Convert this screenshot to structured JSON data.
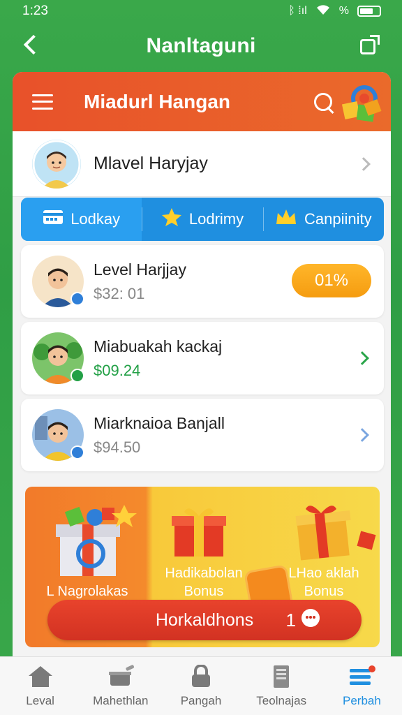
{
  "status_bar": {
    "time": "1:23",
    "signal": "ᛒ ⁞ıl",
    "battery_text": "%"
  },
  "top_nav": {
    "title": "Nanltaguni"
  },
  "header": {
    "title": "Miadurl Hangan"
  },
  "profile": {
    "name": "Mlavel Haryjay"
  },
  "tabs": [
    {
      "label": "Lodkay",
      "icon": "card-icon"
    },
    {
      "label": "Lodrimy",
      "icon": "star-icon"
    },
    {
      "label": "Canpiinity",
      "icon": "crown-icon"
    }
  ],
  "list": [
    {
      "name": "Level Harjjay",
      "amount": "$32: 01",
      "pill": "01%"
    },
    {
      "name": "Miabuakah kackaj",
      "amount": "$09.24"
    },
    {
      "name": "Miarknaioa Banjall",
      "amount": "$94.50"
    }
  ],
  "promo": {
    "left_label": "L Nagrolakas",
    "mid_label_1": "Hadikabolan",
    "mid_label_2": "Bonus",
    "right_label_1": "LHao aklah",
    "right_label_2": "Bonus",
    "button": "Horkaldhons",
    "count": "1"
  },
  "bottom_nav": [
    {
      "label": "Leval"
    },
    {
      "label": "Mahethlan"
    },
    {
      "label": "Pangah"
    },
    {
      "label": "Teolnajas"
    },
    {
      "label": "Perbah"
    }
  ],
  "colors": {
    "background": "#3aa84a",
    "header": "#e8512a",
    "tab_bar": "#1f8fe0",
    "pill": "#f5a11a",
    "accent_green": "#22a046",
    "bottom_active": "#1f8fe0"
  }
}
